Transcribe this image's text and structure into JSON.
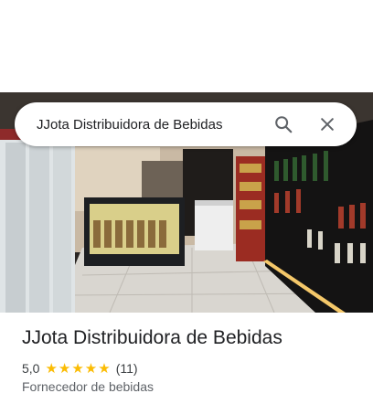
{
  "search": {
    "query": "JJota Distribuidora de Bebidas"
  },
  "place": {
    "name": "JJota Distribuidora de Bebidas",
    "rating": "5,0",
    "stars": "★★★★★",
    "review_count": "(11)",
    "category": "Fornecedor de bebidas"
  },
  "icons": [
    "search-icon",
    "close-icon",
    "star-icon"
  ],
  "colors": {
    "star": "#fbbc04",
    "title": "#202124",
    "secondary": "#5f6368"
  }
}
